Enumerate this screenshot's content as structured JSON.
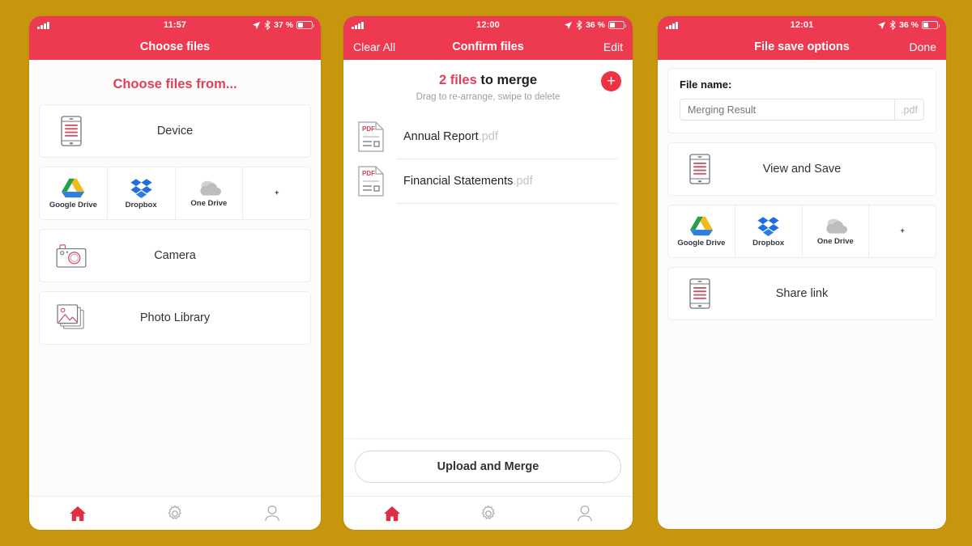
{
  "theme": {
    "background": "#c8960c",
    "accent_red": "#ee3a50",
    "link_red": "#e0415a",
    "text_dark": "#2f3337",
    "muted": "#9b9da0"
  },
  "screens": [
    {
      "status": {
        "time": "11:57",
        "battery": "37 %",
        "icons": [
          "signal-icon",
          "location-arrow-icon",
          "bluetooth-icon",
          "battery-icon"
        ]
      },
      "nav": {
        "title": "Choose files",
        "left": "",
        "right": ""
      },
      "heading": "Choose files from...",
      "device_row": {
        "label": "Device",
        "icon": "device-phone-icon"
      },
      "cloud": [
        {
          "label": "Google Drive",
          "icon": "google-drive-icon"
        },
        {
          "label": "Dropbox",
          "icon": "dropbox-icon"
        },
        {
          "label": "One Drive",
          "icon": "one-drive-icon"
        },
        {
          "label": "+",
          "icon": "plus-icon"
        }
      ],
      "camera_row": {
        "label": "Camera",
        "icon": "camera-icon"
      },
      "photo_row": {
        "label": "Photo Library",
        "icon": "photo-library-icon"
      },
      "tabs": [
        {
          "name": "home",
          "icon": "home-icon",
          "active": true
        },
        {
          "name": "settings",
          "icon": "gear-icon",
          "active": false
        },
        {
          "name": "profile",
          "icon": "person-icon",
          "active": false
        }
      ]
    },
    {
      "status": {
        "time": "12:00",
        "battery": "36 %"
      },
      "nav": {
        "title": "Confirm files",
        "left": "Clear All",
        "right": "Edit"
      },
      "merge_count": "2 files",
      "merge_rest": " to merge",
      "merge_sub": "Drag to re-arrange, swipe to delete",
      "add_button": "+",
      "files": [
        {
          "name": "Annual Report",
          "ext": ".pdf",
          "icon": "pdf-file-icon"
        },
        {
          "name": "Financial Statements",
          "ext": ".pdf",
          "icon": "pdf-file-icon"
        }
      ],
      "primary_button": "Upload and Merge",
      "tabs": [
        {
          "name": "home",
          "icon": "home-icon",
          "active": true
        },
        {
          "name": "settings",
          "icon": "gear-icon",
          "active": false
        },
        {
          "name": "profile",
          "icon": "person-icon",
          "active": false
        }
      ]
    },
    {
      "status": {
        "time": "12:01",
        "battery": "36 %"
      },
      "nav": {
        "title": "File save options",
        "left": "",
        "right": "Done"
      },
      "filename_label": "File name:",
      "filename_value": "Merging Result",
      "filename_placeholder": "Merging Result",
      "filename_suffix": ".pdf",
      "view_save_row": {
        "label": "View and Save",
        "icon": "device-phone-icon"
      },
      "cloud": [
        {
          "label": "Google Drive",
          "icon": "google-drive-icon"
        },
        {
          "label": "Dropbox",
          "icon": "dropbox-icon"
        },
        {
          "label": "One Drive",
          "icon": "one-drive-icon"
        },
        {
          "label": "+",
          "icon": "plus-icon"
        }
      ],
      "share_row": {
        "label": "Share link",
        "icon": "device-phone-icon"
      }
    }
  ]
}
